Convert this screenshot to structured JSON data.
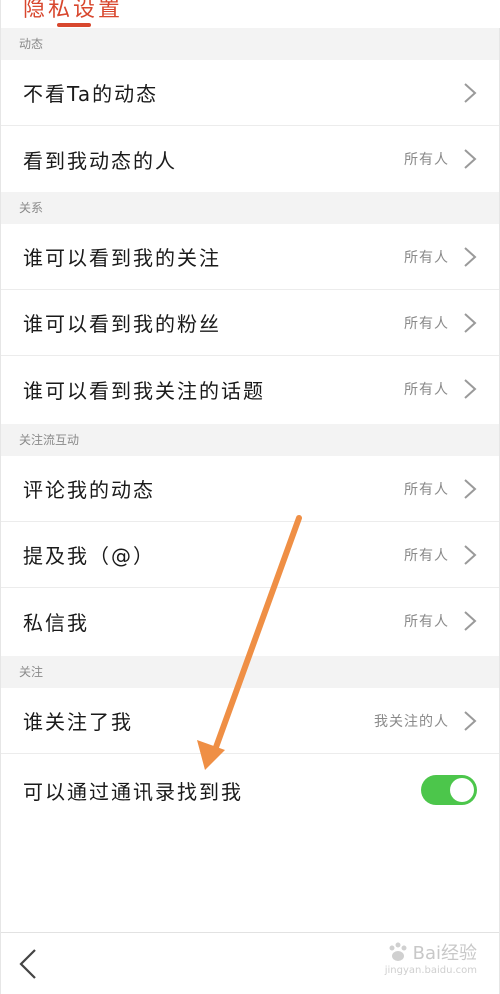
{
  "header": {
    "title": "隐私设置"
  },
  "sections": [
    {
      "title": "动态",
      "rows": [
        {
          "label": "不看Ta的动态",
          "value": ""
        },
        {
          "label": "看到我动态的人",
          "value": "所有人"
        }
      ]
    },
    {
      "title": "关系",
      "rows": [
        {
          "label": "谁可以看到我的关注",
          "value": "所有人"
        },
        {
          "label": "谁可以看到我的粉丝",
          "value": "所有人"
        },
        {
          "label": "谁可以看到我关注的话题",
          "value": "所有人"
        }
      ]
    },
    {
      "title": "关注流互动",
      "rows": [
        {
          "label": "评论我的动态",
          "value": "所有人"
        },
        {
          "label": "提及我（@）",
          "value": "所有人"
        },
        {
          "label": "私信我",
          "value": "所有人"
        }
      ]
    },
    {
      "title": "关注",
      "rows": [
        {
          "label": "谁关注了我",
          "value": "我关注的人"
        },
        {
          "label": "可以通过通讯录找到我",
          "toggle_on": true
        }
      ]
    }
  ],
  "watermark": {
    "text": "Bai经验",
    "sub": "jingyan.baidu.com"
  },
  "colors": {
    "accent": "#d8472e",
    "toggle": "#4cc64b",
    "annotation_arrow": "#ef8f45"
  },
  "icons": {
    "chevron": "chevron-right-icon",
    "back": "chevron-left-icon",
    "watermark_logo": "paw-icon"
  }
}
